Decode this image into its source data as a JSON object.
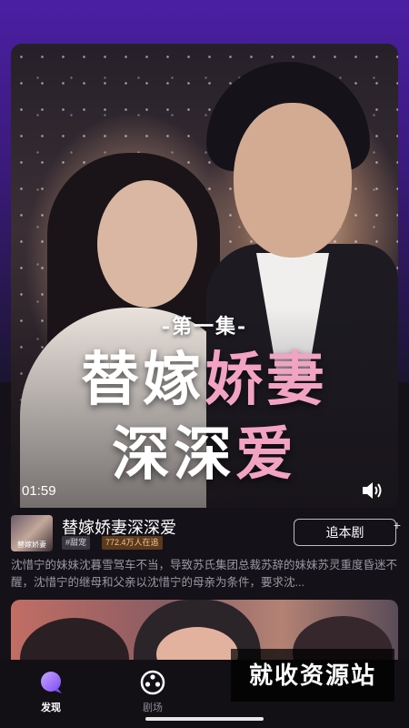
{
  "video": {
    "episode_label": "-第一集-",
    "title_line1_white": "替嫁",
    "title_line1_pink": "娇妻",
    "title_line2_white": "深深",
    "title_line2_pink": "爱",
    "timecode": "01:59",
    "volume_icon": "speaker-icon"
  },
  "drama": {
    "thumbnail_text": "替嫁娇妻",
    "title": "替嫁娇妻深深爱",
    "genre_tag": "#甜宠",
    "viewers_tag": "772.4万人在追",
    "follow_label": "追本剧",
    "follow_plus": "+",
    "synopsis": "沈惜宁的妹妹沈暮雪驾车不当，导致苏氏集团总裁苏辞的妹妹苏灵重度昏迷不醒，沈惜宁的继母和父亲以沈惜宁的母亲为条件，要求沈..."
  },
  "nav": {
    "items": [
      {
        "label": "发现",
        "icon": "discover-bubble-icon",
        "active": true
      },
      {
        "label": "剧场",
        "icon": "film-reel-icon",
        "active": false
      }
    ]
  },
  "watermark": "就收资源站",
  "colors": {
    "accent_purple": "#4b1fa3",
    "title_pink": "#f2a3c2",
    "viewers_tag_text": "#f7c489"
  }
}
